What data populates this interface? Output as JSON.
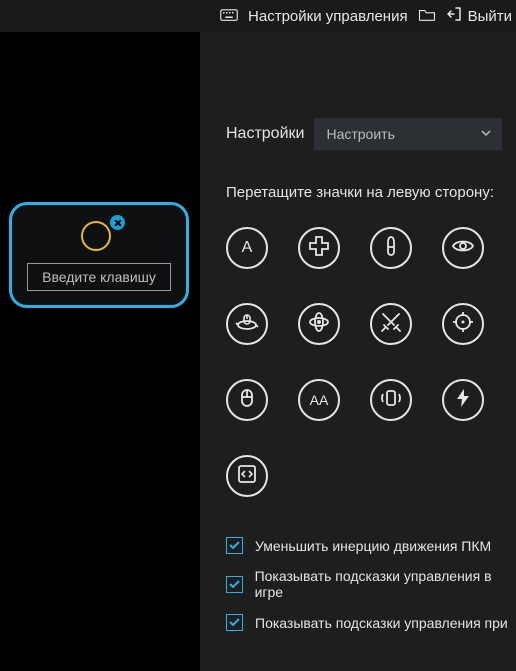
{
  "header": {
    "title": "Настройки управления",
    "exit": "Выйти"
  },
  "mapping": {
    "placeholder": "Введите клавишу"
  },
  "panel": {
    "settings_label": "Настройки",
    "preset_selected": "Настроить",
    "drag_title": "Перетащите значки на левую сторону:"
  },
  "tools": [
    {
      "name": "letter-a",
      "label": "A"
    },
    {
      "name": "dpad",
      "label": ""
    },
    {
      "name": "bullet",
      "label": ""
    },
    {
      "name": "eye",
      "label": ""
    },
    {
      "name": "orbit-mouse",
      "label": ""
    },
    {
      "name": "orbit",
      "label": ""
    },
    {
      "name": "swords",
      "label": ""
    },
    {
      "name": "target",
      "label": ""
    },
    {
      "name": "mouse",
      "label": ""
    },
    {
      "name": "double-a",
      "label": "AA"
    },
    {
      "name": "shake",
      "label": ""
    },
    {
      "name": "lightning",
      "label": ""
    },
    {
      "name": "code",
      "label": ""
    }
  ],
  "options": [
    {
      "label": "Уменьшить инерцию движения ПКМ",
      "checked": true
    },
    {
      "label": "Показывать подсказки управления в игре",
      "checked": true
    },
    {
      "label": "Показывать подсказки управления при",
      "checked": true
    }
  ]
}
